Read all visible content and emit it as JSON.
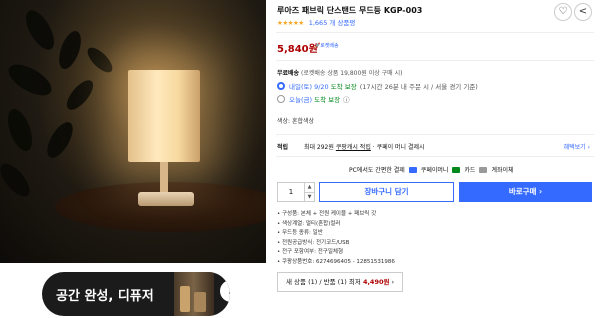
{
  "banner": {
    "text": "공간 완성, 디퓨저",
    "arrow": "›"
  },
  "product": {
    "title": "루아즈 패브릭 단스탠드 무드등 KGP-003",
    "stars": "★★★★★",
    "review_count": "1,665 개 상품평",
    "price": "5,840원",
    "rocket_badge": "로켓배송"
  },
  "shipping": {
    "label": "무료배송",
    "detail": "(로켓배송 상품 19,800원 이상 구매 시)",
    "options": [
      {
        "day": "내일(토) 9/20",
        "status": "도착 보장",
        "note": "(17시간 26분 내 주문 시 / 서울 경기 기준)",
        "selected": true
      },
      {
        "day": "오늘(금)",
        "status": "도착 보장",
        "note": "",
        "selected": false
      }
    ]
  },
  "seller": "색상: 혼합색상",
  "cash": {
    "label": "적립",
    "text_before": "최대 292원",
    "text_link": "쿠팡캐시 적립",
    "text_after": " · 쿠페이 머니 결제시",
    "more_link": "혜택보기 ›"
  },
  "payment": {
    "text": "PC에서도 간편한 결제",
    "methods": [
      "쿠페이머니",
      "카드",
      "계좌이체"
    ],
    "colors": [
      "#346aff",
      "#00891a",
      "#999999"
    ]
  },
  "purchase": {
    "quantity": "1",
    "cart_label": "장바구니 담기",
    "buy_label": "바로구매 ›"
  },
  "specs": [
    "구성품: 본체 + 전원 케이블 + 패브릭 갓",
    "색상계열: 멀티(혼합)컬러",
    "무드등 종류: 일반",
    "전원공급방식: 전기코드/USB",
    "전구 포함여부: 전구일체형",
    "쿠팡상품번호: 6274696405 - 12851531986"
  ],
  "other_sellers": {
    "text": "새 상품 (1) / 반품 (1) 최저 ",
    "price": "4,490원",
    "arrow": " ›"
  },
  "icons": {
    "heart": "♡",
    "share": "<"
  }
}
